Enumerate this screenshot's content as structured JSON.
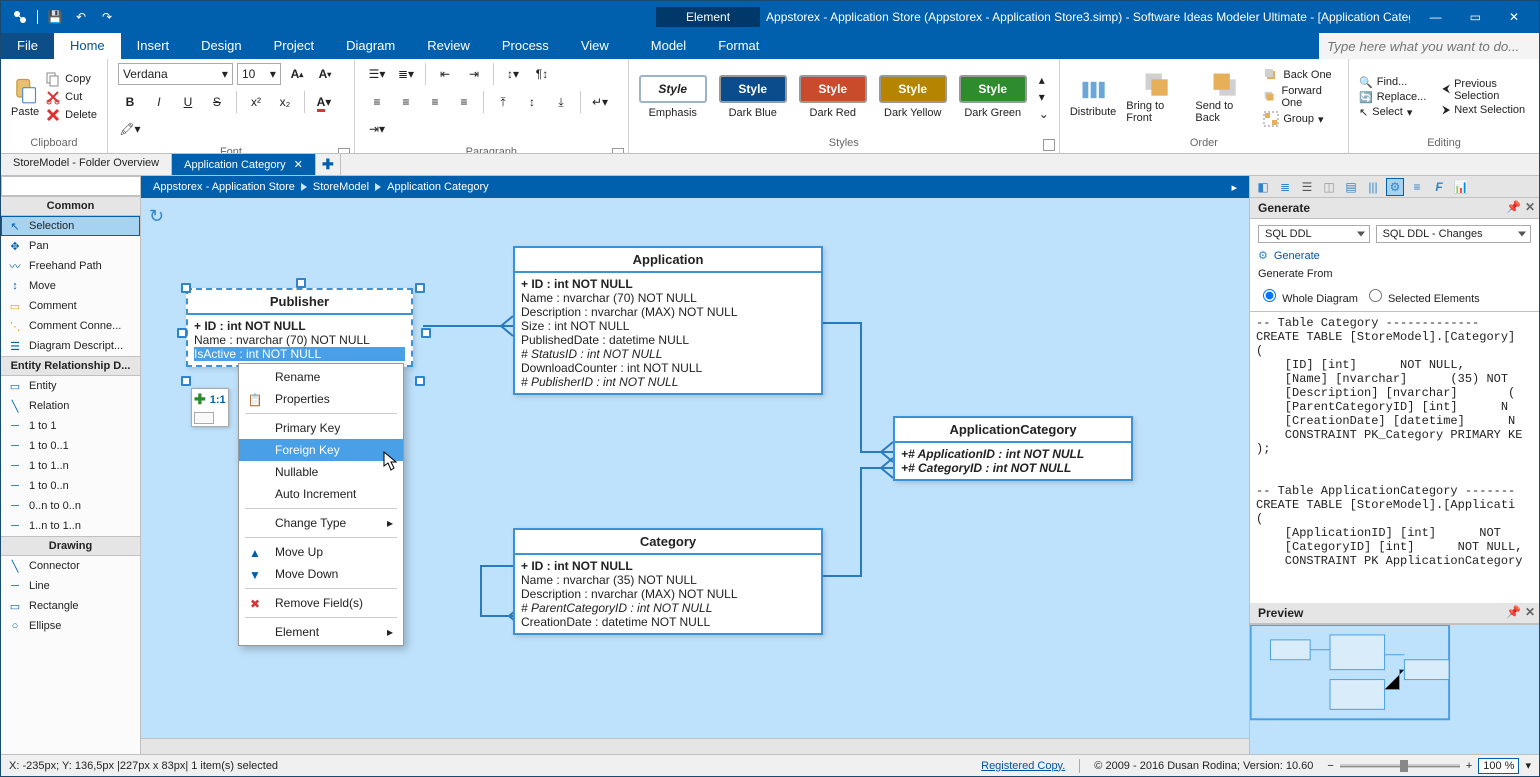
{
  "title_context_tab": "Element",
  "window_title": "Appstorex - Application Store (Appstorex - Application Store3.simp)  - Software Ideas Modeler Ultimate - [Application Category]",
  "menu": [
    "File",
    "Home",
    "Insert",
    "Design",
    "Project",
    "Diagram",
    "Review",
    "Process",
    "View",
    "Model",
    "Format"
  ],
  "menu_active": "Home",
  "menu_context": "Format",
  "search_placeholder": "Type here what you want to do...",
  "clipboard": {
    "paste": "Paste",
    "copy": "Copy",
    "cut": "Cut",
    "delete": "Delete",
    "label": "Clipboard"
  },
  "font": {
    "family": "Verdana",
    "size": "10",
    "label": "Font"
  },
  "paragraph_label": "Paragraph",
  "styles": {
    "label": "Styles",
    "style_word": "Style",
    "items": [
      "Emphasis",
      "Dark Blue",
      "Dark Red",
      "Dark Yellow",
      "Dark Green"
    ]
  },
  "order": {
    "label": "Order",
    "distribute": "Distribute",
    "bring": "Bring to Front",
    "send": "Send to Back",
    "rows": [
      "Back One",
      "Forward One",
      "Group"
    ]
  },
  "editing": {
    "label": "Editing",
    "items": [
      "Find...",
      "Replace...",
      "Select",
      "Previous Selection",
      "Next Selection"
    ]
  },
  "doc_tabs": {
    "inactive": "StoreModel - Folder Overview",
    "active": "Application Category"
  },
  "breadcrumb": [
    "Appstorex - Application Store",
    "StoreModel",
    "Application Category"
  ],
  "toolbox": {
    "common": "Common",
    "common_items": [
      "Selection",
      "Pan",
      "Freehand Path",
      "Move",
      "Comment",
      "Comment Conne...",
      "Diagram Descript..."
    ],
    "erd": "Entity Relationship D...",
    "erd_items": [
      "Entity",
      "Relation",
      "1 to 1",
      "1 to 0..1",
      "1 to 1..n",
      "1 to 0..n",
      "0..n to 0..n",
      "1..n to 1..n"
    ],
    "drawing": "Drawing",
    "drawing_items": [
      "Connector",
      "Line",
      "Rectangle",
      "Ellipse"
    ]
  },
  "entities": {
    "publisher": {
      "title": "Publisher",
      "attrs": [
        "+ ID : int NOT NULL",
        "Name : nvarchar (70)  NOT NULL",
        "IsActive : int NOT NULL"
      ]
    },
    "application": {
      "title": "Application",
      "attrs": [
        "+ ID : int NOT NULL",
        "Name : nvarchar (70)  NOT NULL",
        "Description : nvarchar (MAX)  NOT NULL",
        "Size : int NOT NULL",
        "PublishedDate : datetime NULL",
        "# StatusID : int NOT NULL",
        "DownloadCounter : int NOT NULL",
        "# PublisherID : int NOT NULL"
      ]
    },
    "category": {
      "title": "Category",
      "attrs": [
        "+ ID : int NOT NULL",
        "Name : nvarchar (35)  NOT NULL",
        "Description : nvarchar (MAX)  NOT NULL",
        "# ParentCategoryID : int NOT NULL",
        "CreationDate : datetime NOT NULL"
      ]
    },
    "appcat": {
      "title": "ApplicationCategory",
      "attrs": [
        "+# ApplicationID : int NOT NULL",
        "+# CategoryID : int NOT NULL"
      ]
    }
  },
  "mini_menu_label": "1:1",
  "context_menu": {
    "items": [
      "Rename",
      "Properties",
      "Primary Key",
      "Foreign Key",
      "Nullable",
      "Auto Increment",
      "Change Type",
      "Move Up",
      "Move Down",
      "Remove Field(s)",
      "Element"
    ],
    "highlight": "Foreign Key"
  },
  "generate": {
    "panel_label": "Generate",
    "combo1": "SQL DDL",
    "combo2": "SQL DDL - Changes",
    "generate_btn": "Generate",
    "from_label": "Generate From",
    "from_whole": "Whole Diagram",
    "from_sel": "Selected Elements"
  },
  "sql_text": "-- Table Category -------------\nCREATE TABLE [StoreModel].[Category]\n(\n    [ID] [int]      NOT NULL,\n    [Name] [nvarchar]      (35) NOT\n    [Description] [nvarchar]       (\n    [ParentCategoryID] [int]      N\n    [CreationDate] [datetime]      N\n    CONSTRAINT PK_Category PRIMARY KE\n);\n\n\n-- Table ApplicationCategory -------\nCREATE TABLE [StoreModel].[Applicati\n(\n    [ApplicationID] [int]      NOT\n    [CategoryID] [int]      NOT NULL,\n    CONSTRAINT PK ApplicationCategory",
  "preview_label": "Preview",
  "status": {
    "left": "X: -235px; Y: 136,5px  |227px x 83px| 1 item(s) selected",
    "registered": "Registered Copy.",
    "copyright": "© 2009 - 2016 Dusan Rodina; Version: 10.60",
    "zoom": "100 %"
  }
}
